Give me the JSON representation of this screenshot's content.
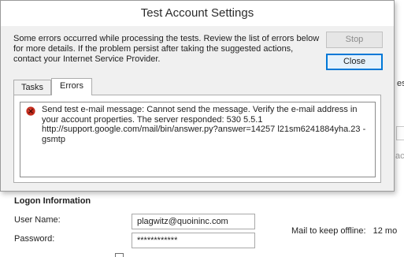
{
  "dialog": {
    "title": "Test Account Settings",
    "message": "Some errors occurred while processing the tests. Review the list of errors below for more details. If the problem persist after taking the suggested actions, contact your Internet Service Provider.",
    "stop_label": "Stop",
    "close_label": "Close",
    "tabs": [
      {
        "label": "Tasks",
        "active": false
      },
      {
        "label": "Errors",
        "active": true
      }
    ],
    "errors": [
      {
        "icon": "error-x-icon",
        "text": "Send test e-mail message: Cannot send the message. Verify the e-mail address in your account properties.  The server responded: 530 5.5.1 http://support.google.com/mail/bin/answer.py?answer=14257 l21sm6241884yha.23 - gsmtp"
      }
    ]
  },
  "background": {
    "logon_header": "Logon Information",
    "username_label": "User Name:",
    "username_value": "plagwitz@quoininc.com",
    "password_label": "Password:",
    "password_value": "************",
    "offline_label": "Mail to keep offline:",
    "offline_value": "12 mo",
    "partial_right_1": "es",
    "partial_right_2": "acc"
  },
  "colors": {
    "accent": "#0078d7",
    "error_red": "#c42b1c"
  }
}
